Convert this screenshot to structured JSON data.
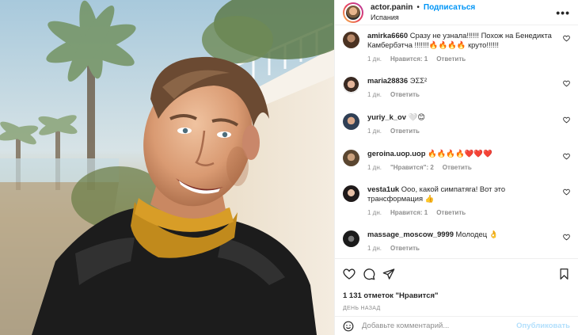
{
  "photo": {
    "alt": "selfie"
  },
  "header": {
    "username": "actor.panin",
    "separator": "•",
    "follow_label": "Подписаться",
    "location": "Испания",
    "more_label": "•••"
  },
  "comments": [
    {
      "user": "amirka6660",
      "text": "Сразу не узнала!!!!!! Похож на Бенедикта Камбербэтча !!!!!!!🔥🔥🔥🔥 круто!!!!!!",
      "time": "1 дн.",
      "likes": "Нравится: 1",
      "reply": "Ответить"
    },
    {
      "user": "maria28836",
      "text": "ЭΣΣ²",
      "time": "1 дн.",
      "likes": "",
      "reply": "Ответить"
    },
    {
      "user": "yuriy_k_ov",
      "text": "🤍😊",
      "time": "1 дн.",
      "likes": "",
      "reply": "Ответить"
    },
    {
      "user": "geroina.uop.uop",
      "text": "🔥🔥🔥🔥❤️❤️❤️",
      "time": "1 дн.",
      "likes": "\"Нравится\": 2",
      "reply": "Ответить"
    },
    {
      "user": "vesta1uk",
      "text": "Ооо, какой симпатяга! Вот это трансформация 👍",
      "time": "1 дн.",
      "likes": "Нравится: 1",
      "reply": "Ответить"
    },
    {
      "user": "massage_moscow_9999",
      "text": "Молодец 👌",
      "time": "1 дн.",
      "likes": "",
      "reply": "Ответить"
    }
  ],
  "likes_text": "1 131 отметок \"Нравится\"",
  "date_text": "ДЕНЬ НАЗАД",
  "add_comment": {
    "placeholder": "Добавьте комментарий...",
    "publish_label": "Опубликовать"
  }
}
